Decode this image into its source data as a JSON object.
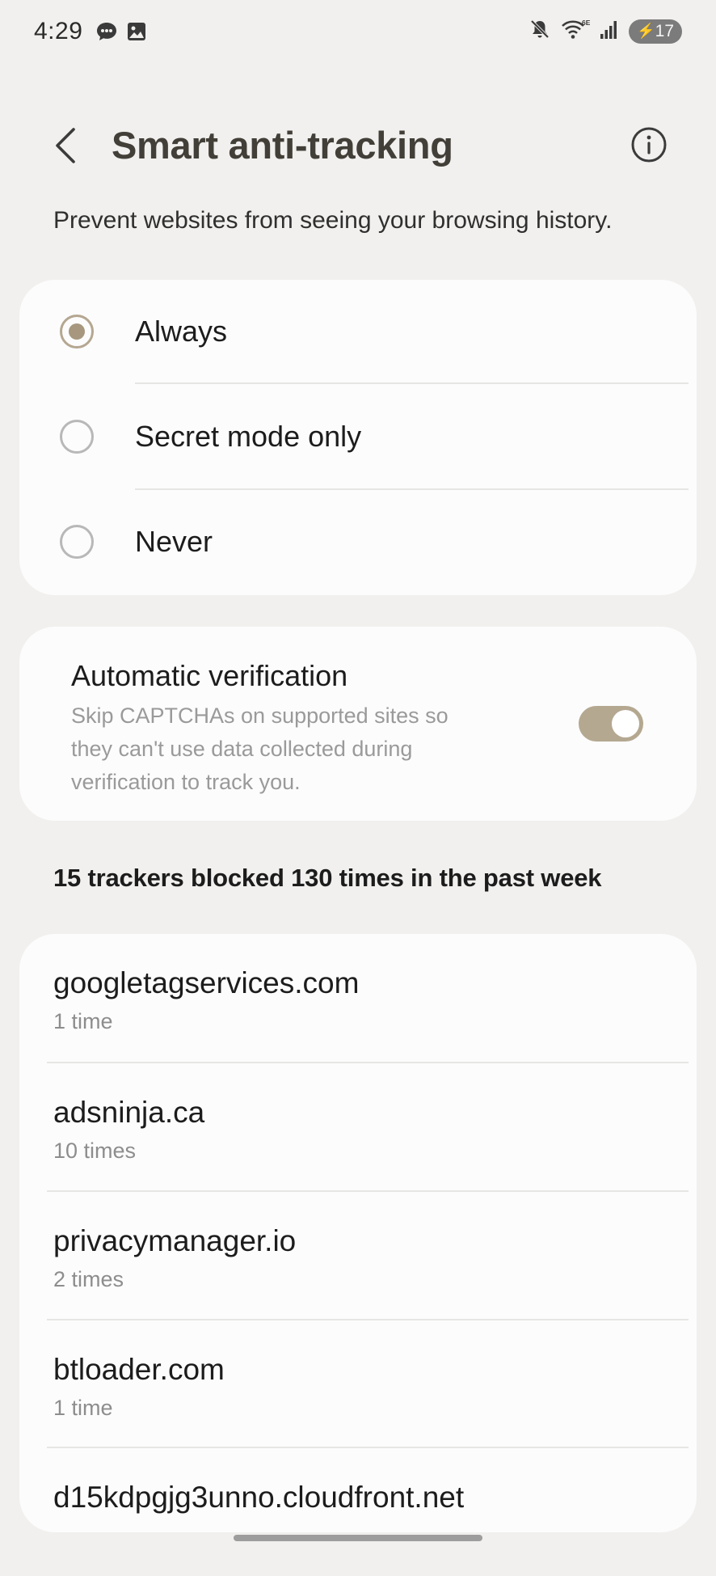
{
  "status_bar": {
    "time": "4:29",
    "battery_level": "17",
    "icons": [
      "chat-icon",
      "image-icon",
      "mute-icon",
      "wifi-6e-icon",
      "signal-icon",
      "battery-charging-icon"
    ]
  },
  "header": {
    "title": "Smart anti-tracking",
    "back_icon": "back-chevron-icon",
    "info_icon": "info-icon"
  },
  "description": "Prevent websites from seeing your browsing history.",
  "tracking_options": {
    "selected": "Always",
    "items": [
      {
        "label": "Always",
        "checked": true
      },
      {
        "label": "Secret mode only",
        "checked": false
      },
      {
        "label": "Never",
        "checked": false
      }
    ]
  },
  "automatic_verification": {
    "title": "Automatic verification",
    "description": "Skip CAPTCHAs on supported sites so they can't use data collected during verification to track you.",
    "enabled": true
  },
  "trackers": {
    "summary": "15 trackers blocked 130 times in the past week",
    "items": [
      {
        "domain": "googletagservices.com",
        "count": "1 time"
      },
      {
        "domain": "adsninja.ca",
        "count": "10 times"
      },
      {
        "domain": "privacymanager.io",
        "count": "2 times"
      },
      {
        "domain": "btloader.com",
        "count": "1 time"
      },
      {
        "domain": "d15kdpgjg3unno.cloudfront.net",
        "count": ""
      }
    ]
  },
  "colors": {
    "background": "#f1f0ee",
    "card": "#fcfcfc",
    "accent": "#b4a891",
    "title": "#423f38",
    "secondary_text": "#8d8d8d"
  }
}
